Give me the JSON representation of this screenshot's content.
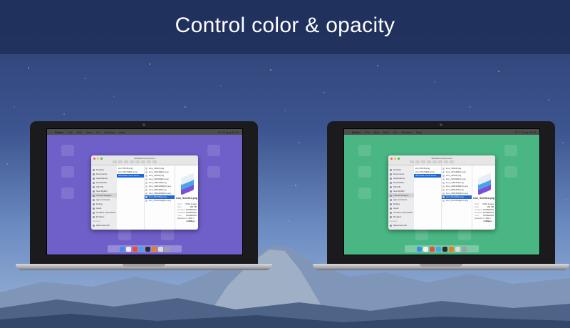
{
  "banner": {
    "title": "Control color & opacity"
  },
  "colors": {
    "purple_tint": "#6f5fc9",
    "green_tint": "#49b683",
    "banner_bg": "#20305c"
  },
  "menubar": {
    "apple": "",
    "app": "Finder",
    "items": [
      "File",
      "Edit",
      "View",
      "Go",
      "Window",
      "Help"
    ],
    "clock": "Fri 12 Aug 16:24"
  },
  "finder": {
    "window_title": "Windows Focus icons",
    "sidebar": [
      {
        "label": "Desktop"
      },
      {
        "label": "Documents"
      },
      {
        "label": "Applications"
      },
      {
        "label": "Downloads"
      },
      {
        "label": "OSX.lib"
      },
      {
        "label": "New MyMO"
      },
      {
        "label": "TPL-00 Designs"
      },
      {
        "label": "app icon/icons"
      },
      {
        "label": "Debug"
      },
      {
        "label": "Good"
      },
      {
        "label": "Creative Cloud Files"
      },
      {
        "label": "Dropbox"
      },
      {
        "label": "Devices"
      },
      {
        "label": "Macintosh HD"
      }
    ],
    "col1": [
      "icon TB-35.png",
      "icon 70x70@2x.png",
      "Windows Focus icons",
      "",
      "",
      "",
      "",
      ""
    ],
    "col2": [
      "icon_16x16.png",
      "icon_16x16@2x.png",
      "icon_32x32.png",
      "icon_32x32@2x.png",
      "icon_128x128.png",
      "icon_128x128@2x.png",
      "icon_256x256.png",
      "icon_256x256@2x.png",
      "icon_512x512.png",
      "icon_512x512@2x.png"
    ],
    "preview_name": "icon_512x512.png",
    "meta": [
      {
        "k": "Kind",
        "v": "PNG image"
      },
      {
        "k": "Size",
        "v": "118 KB"
      },
      {
        "k": "Created",
        "v": "10/08/2016"
      },
      {
        "k": "Modified",
        "v": "10/08/2016"
      },
      {
        "k": "Last opened",
        "v": "10/08/2016"
      },
      {
        "k": "Dimensions",
        "v": "512 × 512"
      },
      {
        "k": "",
        "v": "Add Tags..."
      }
    ]
  }
}
